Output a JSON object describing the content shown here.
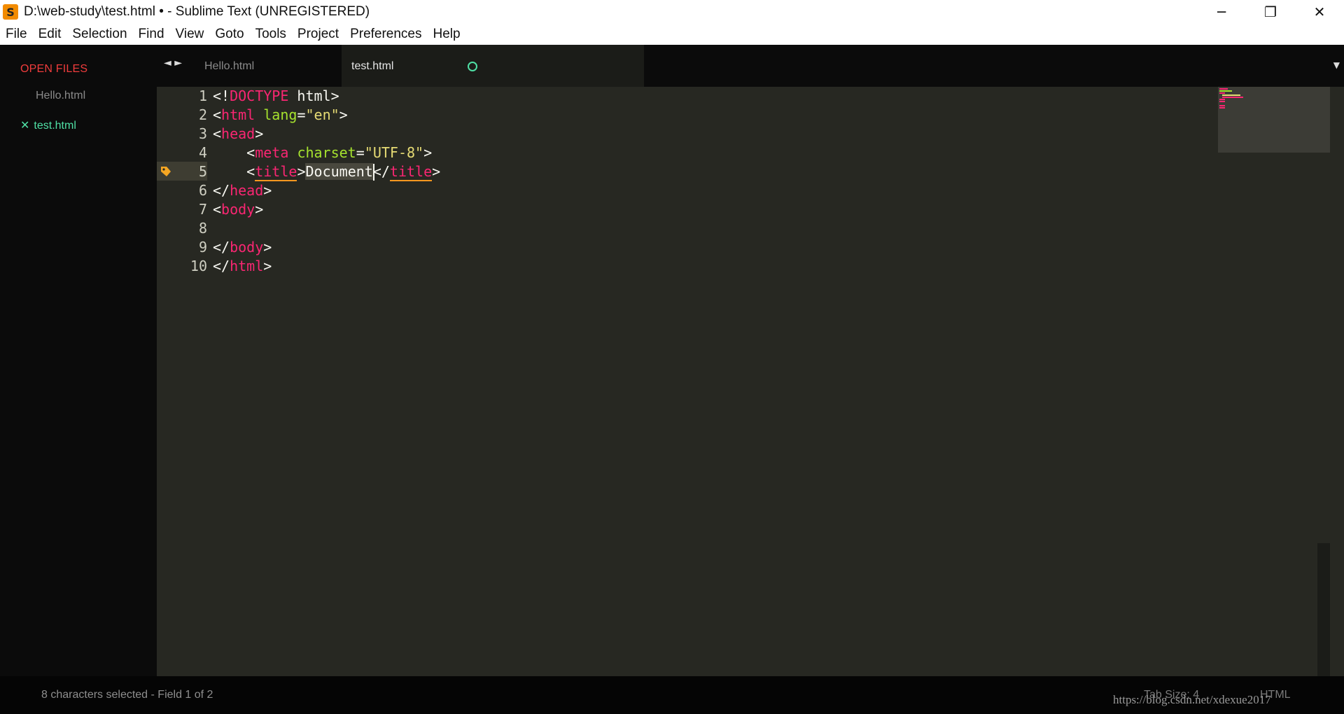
{
  "window": {
    "app_icon": "S",
    "title": "D:\\web-study\\test.html • - Sublime Text (UNREGISTERED)",
    "controls": {
      "minimize": "─",
      "restore": "❐",
      "close": "✕"
    }
  },
  "menu": [
    "File",
    "Edit",
    "Selection",
    "Find",
    "View",
    "Goto",
    "Tools",
    "Project",
    "Preferences",
    "Help"
  ],
  "sidebar": {
    "heading": "OPEN FILES",
    "files": [
      "Hello.html",
      "test.html"
    ],
    "close_glyph": "✕"
  },
  "tabs": {
    "nav_arrows": "◄ ►",
    "items": [
      "Hello.html",
      "test.html"
    ],
    "active": "test.html",
    "dropdown": "▼"
  },
  "editor": {
    "line_numbers": [
      "1",
      "2",
      "3",
      "4",
      "5",
      "6",
      "7",
      "8",
      "9",
      "10"
    ],
    "current_line": 5,
    "bookmark_icon": "tag-icon",
    "code": {
      "l1": [
        "<!",
        "DOCTYPE",
        " html>"
      ],
      "l2": [
        "<",
        "html",
        " ",
        "lang",
        "=",
        "\"en\"",
        ">"
      ],
      "l3": [
        "<",
        "head",
        ">"
      ],
      "l4": [
        "    <",
        "meta",
        " ",
        "charset",
        "=",
        "\"UTF-8\"",
        ">"
      ],
      "l5": [
        "    <",
        "title",
        ">",
        "Document",
        "</",
        "title",
        ">"
      ],
      "l6": [
        "</",
        "head",
        ">"
      ],
      "l7": [
        "<",
        "body",
        ">"
      ],
      "l8": [
        ""
      ],
      "l9": [
        "</",
        "body",
        ">"
      ],
      "l10": [
        "</",
        "html",
        ">"
      ]
    }
  },
  "statusbar": {
    "left": "8 characters selected - Field 1 of 2",
    "tab_size": "Tab Size: 4",
    "syntax": "HTML"
  },
  "watermark": "https://blog.csdn.net/xdexue2017",
  "colors": {
    "background": "#272822",
    "tag": "#f92672",
    "attribute": "#a6e22e",
    "string": "#e6db74",
    "text": "#f8f8f2",
    "sidebar_heading": "#f03c3c",
    "active_file": "#4fe0a5"
  }
}
